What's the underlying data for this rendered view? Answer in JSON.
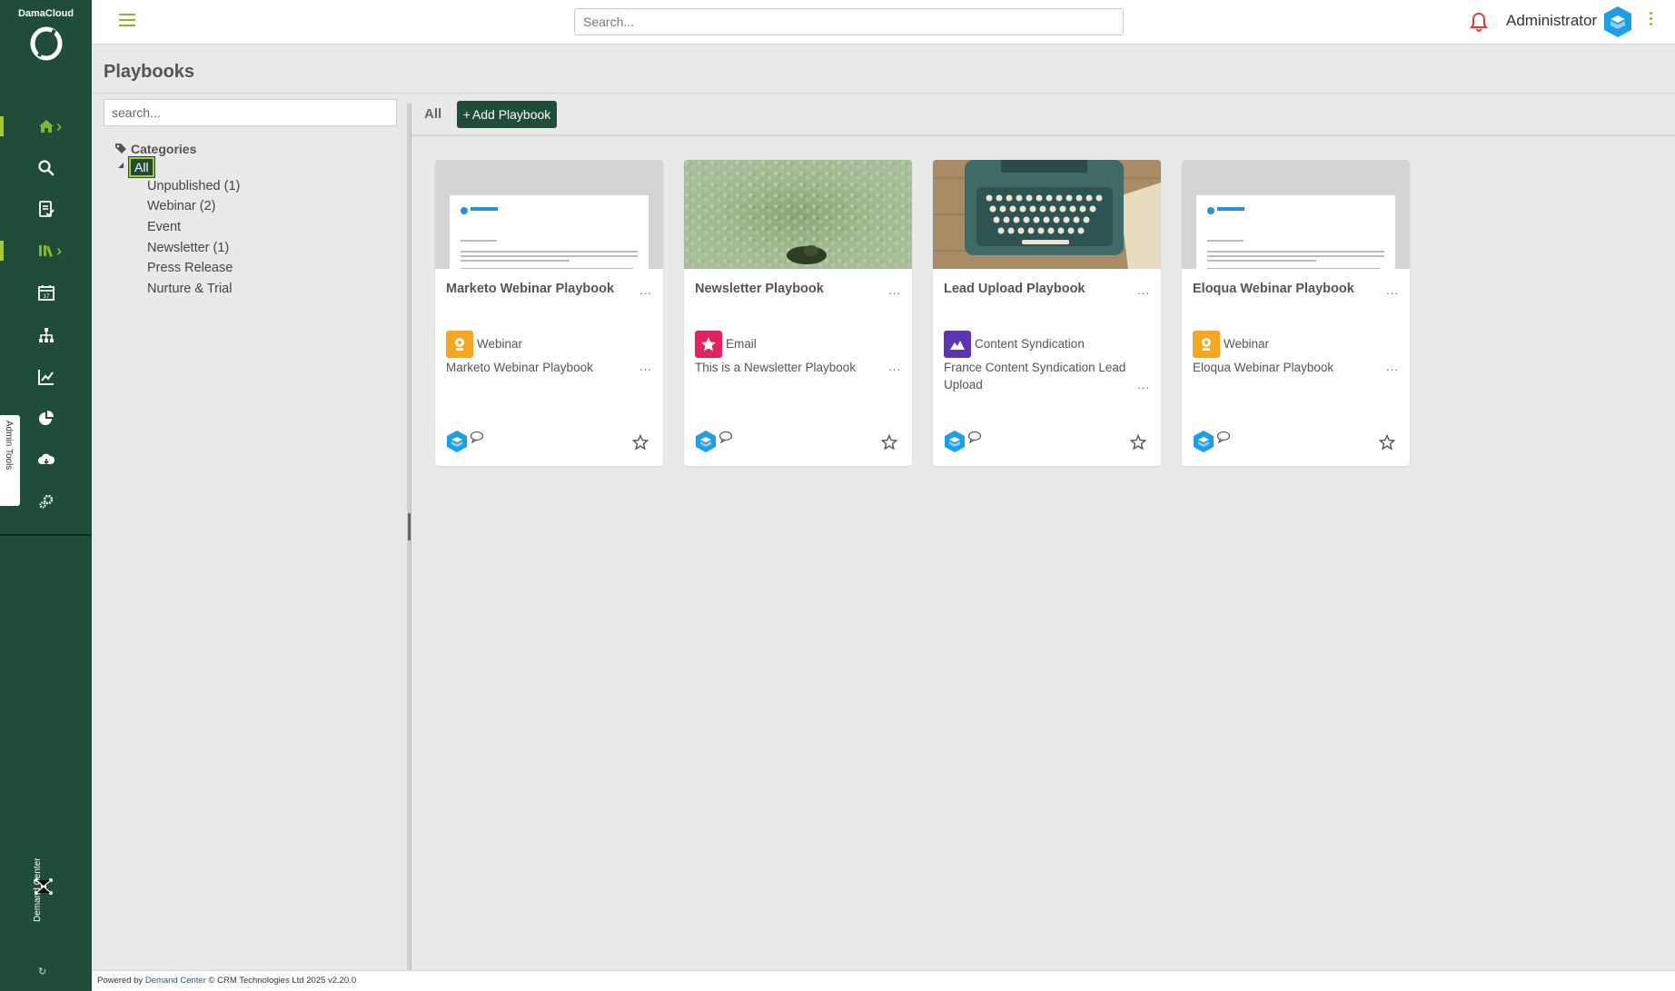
{
  "brand": {
    "name": "DamaCloud"
  },
  "sidebar": {
    "items": [
      {
        "name": "home",
        "icon": "home-icon",
        "active": true,
        "expandable": true
      },
      {
        "name": "search",
        "icon": "search-icon",
        "active": false,
        "expandable": false
      },
      {
        "name": "tasks",
        "icon": "checklist-icon",
        "active": false,
        "expandable": false
      },
      {
        "name": "library",
        "icon": "library-icon",
        "active": true,
        "expandable": true
      },
      {
        "name": "calendar",
        "icon": "calendar-icon",
        "active": false,
        "expandable": false
      },
      {
        "name": "hierarchy",
        "icon": "org-chart-icon",
        "active": false,
        "expandable": false
      },
      {
        "name": "analytics",
        "icon": "line-chart-icon",
        "active": false,
        "expandable": false
      },
      {
        "name": "reports",
        "icon": "pie-chart-icon",
        "active": false,
        "expandable": false
      },
      {
        "name": "cloud",
        "icon": "cloud-icon",
        "active": false,
        "expandable": false
      },
      {
        "name": "integrations",
        "icon": "gears-icon",
        "active": false,
        "expandable": false
      }
    ],
    "admin_tools_label": "Admin Tools",
    "bottom_brand": "Demand Center"
  },
  "topbar": {
    "search_placeholder": "Search...",
    "user_name": "Administrator"
  },
  "page": {
    "title": "Playbooks"
  },
  "categories": {
    "search_placeholder": "search...",
    "heading": "Categories",
    "selected": "All",
    "items": [
      "Unpublished (1)",
      "Webinar (2)",
      "Event",
      "Newsletter (1)",
      "Press Release",
      "Nurture & Trial"
    ]
  },
  "filter": {
    "active_tab": "All",
    "add_button_label": "Add Playbook"
  },
  "playbooks": [
    {
      "title": "Marketo Webinar Playbook",
      "type": "Webinar",
      "type_color": "#f5a623",
      "description": "Marketo Webinar Playbook",
      "thumbnail": "document"
    },
    {
      "title": "Newsletter Playbook",
      "type": "Email",
      "type_color": "#e0245e",
      "description": "This is a Newsletter Playbook",
      "thumbnail": "duckweed-photo"
    },
    {
      "title": "Lead Upload Playbook",
      "type": "Content Syndication",
      "type_color": "#5e35b1",
      "description": "France Content Syndication Lead Upload",
      "thumbnail": "typewriter-photo"
    },
    {
      "title": "Eloqua Webinar Playbook",
      "type": "Webinar",
      "type_color": "#f5a623",
      "description": "Eloqua Webinar Playbook",
      "thumbnail": "document"
    }
  ],
  "footer": {
    "powered_by": "Powered by",
    "link_text": "Demand Center",
    "copyright": "© CRM Technologies Ltd 2025 v2.20.0"
  },
  "colors": {
    "sidebar": "#1f4d3a",
    "accent": "#a8c93a",
    "notification": "#e53935"
  }
}
